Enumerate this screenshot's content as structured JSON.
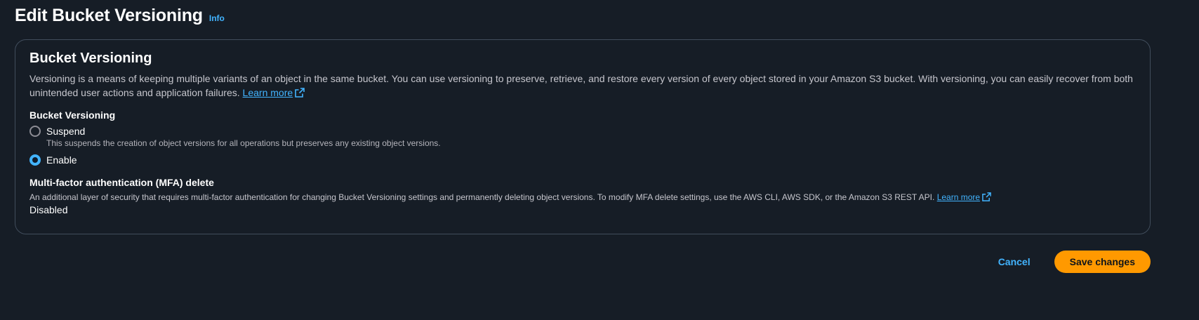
{
  "header": {
    "title": "Edit Bucket Versioning",
    "info_label": "Info"
  },
  "panel": {
    "title": "Bucket Versioning",
    "description": "Versioning is a means of keeping multiple variants of an object in the same bucket. You can use versioning to preserve, retrieve, and restore every version of every object stored in your Amazon S3 bucket. With versioning, you can easily recover from both unintended user actions and application failures.",
    "learn_more": "Learn more",
    "field_label": "Bucket Versioning",
    "options": [
      {
        "label": "Suspend",
        "hint": "This suspends the creation of object versions for all operations but preserves any existing object versions.",
        "selected": false
      },
      {
        "label": "Enable",
        "hint": "",
        "selected": true
      }
    ],
    "mfa": {
      "title": "Multi-factor authentication (MFA) delete",
      "description": "An additional layer of security that requires multi-factor authentication for changing Bucket Versioning settings and permanently deleting object versions. To modify MFA delete settings, use the AWS CLI, AWS SDK, or the Amazon S3 REST API.",
      "learn_more": "Learn more",
      "value": "Disabled"
    }
  },
  "footer": {
    "cancel_label": "Cancel",
    "save_label": "Save changes"
  },
  "colors": {
    "background": "#161d26",
    "link": "#42b4ff",
    "primary_button": "#ff9900",
    "border": "#414d5c"
  },
  "icons": {
    "external_link": "external-link-icon",
    "radio_unselected": "radio-unselected-icon",
    "radio_selected": "radio-selected-icon"
  }
}
